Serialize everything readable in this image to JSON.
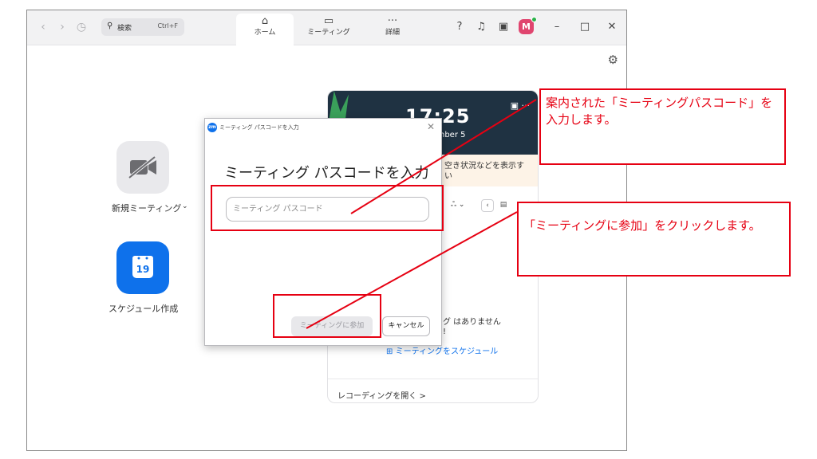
{
  "titlebar": {
    "back_icon": "chevron-left-icon",
    "forward_icon": "chevron-right-icon",
    "history_icon": "clock-icon",
    "search_label": "検索",
    "search_shortcut": "Ctrl+F",
    "tabs": [
      {
        "label": "ホーム",
        "icon": "home-icon",
        "active": true
      },
      {
        "label": "ミーティング",
        "icon": "video-icon",
        "active": false
      },
      {
        "label": "詳細",
        "icon": "more-icon",
        "active": false
      }
    ],
    "help_icon": "help-icon",
    "bell_icon": "bell-icon",
    "calendar_icon": "calendar-icon",
    "avatar_letter": "M",
    "minimize_icon": "minimize-icon",
    "maximize_icon": "maximize-icon",
    "close_icon": "close-icon"
  },
  "home": {
    "new_meeting_label": "新規ミーティング",
    "schedule_label": "スケジュール作成",
    "calendar_day": "19"
  },
  "panel": {
    "clock": "17:25",
    "date": "nber 5",
    "notice_line1": "空き状況などを表示す",
    "notice_line2": "い",
    "no_meetings_line1": "グ はありません",
    "no_meetings_line2": "!",
    "schedule_link": "ミーティングをスケジュール",
    "recordings_link": "レコーディングを開く >"
  },
  "dialog": {
    "caption": "ミーティング パスコードを入力",
    "heading": "ミーティング パスコードを入力",
    "placeholder": "ミーティング パスコード",
    "join_label": "ミーティングに参加",
    "cancel_label": "キャンセル"
  },
  "annotations": {
    "callout1": "案内された「ミーティングパスコード」を入力します。",
    "callout2": "「ミーティングに参加」をクリックします。",
    "color": "#e60012"
  }
}
